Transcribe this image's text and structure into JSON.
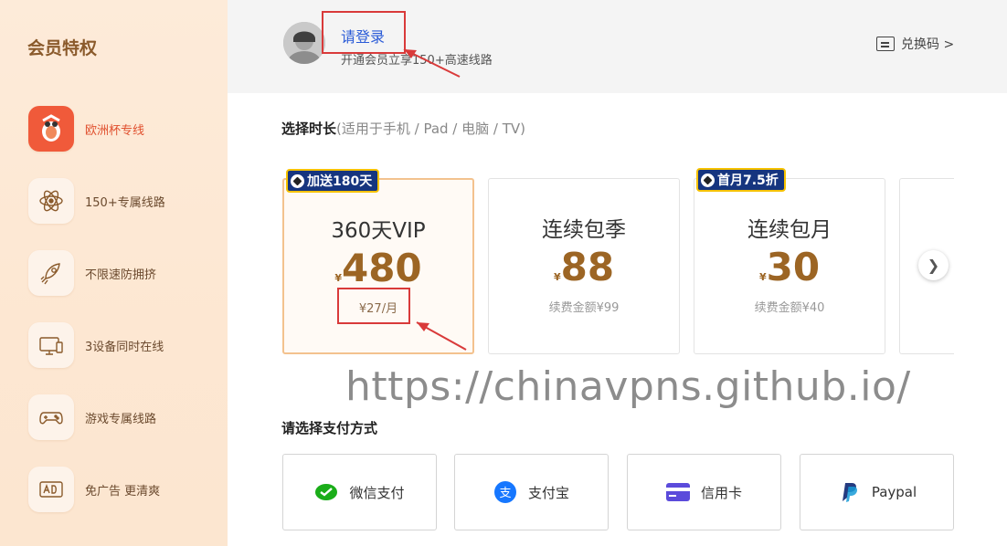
{
  "sidebar": {
    "title": "会员特权",
    "items": [
      {
        "label": "欧洲杯专线",
        "icon": "mascot-icon"
      },
      {
        "label": "150+专属线路",
        "icon": "atom-icon"
      },
      {
        "label": "不限速防拥挤",
        "icon": "rocket-icon"
      },
      {
        "label": "3设备同时在线",
        "icon": "devices-icon"
      },
      {
        "label": "游戏专属线路",
        "icon": "gamepad-icon"
      },
      {
        "label": "免广告 更清爽",
        "icon": "no-ad-icon"
      }
    ]
  },
  "header": {
    "login_label": "请登录",
    "login_sub": "开通会员立享150+高速线路",
    "redeem_label": "兑换码 >"
  },
  "duration": {
    "title": "选择时长",
    "subtitle": "(适用于手机 / Pad / 电脑 / TV)",
    "plans": [
      {
        "name": "360天VIP",
        "currency": "¥",
        "price": "480",
        "note": "¥27/月",
        "badge": "加送180天"
      },
      {
        "name": "连续包季",
        "currency": "¥",
        "price": "88",
        "note": "续费金额¥99",
        "badge": ""
      },
      {
        "name": "连续包月",
        "currency": "¥",
        "price": "30",
        "note": "续费金额¥40",
        "badge": "首月7.5折"
      }
    ]
  },
  "watermark": "https://chinavpns.github.io/",
  "payment": {
    "title": "请选择支付方式",
    "methods": [
      {
        "label": "微信支付",
        "icon": "wechat-pay-icon",
        "color": "#1aad19"
      },
      {
        "label": "支付宝",
        "icon": "alipay-icon",
        "color": "#1677ff"
      },
      {
        "label": "信用卡",
        "icon": "credit-card-icon",
        "color": "#5b4bdb"
      },
      {
        "label": "Paypal",
        "icon": "paypal-icon",
        "color": "#253b80"
      }
    ]
  },
  "colors": {
    "accent_red": "#d93a3a",
    "price_brown": "#9c6524",
    "login_blue": "#2a5bd7",
    "badge_navy": "#16357f"
  }
}
